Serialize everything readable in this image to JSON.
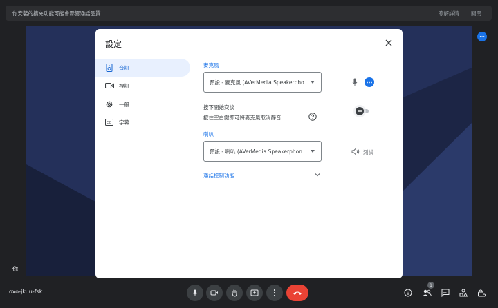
{
  "banner": {
    "message": "你安裝的擴充功能可能會影響通話品質",
    "learn_more": "瞭解詳情",
    "close": "關閉"
  },
  "participant": {
    "name": "你"
  },
  "meeting": {
    "code": "oxo-jkuu-fsk",
    "participants_count": "1"
  },
  "settings": {
    "title": "設定",
    "nav": [
      {
        "label": "音訊",
        "icon": "speaker-device-icon",
        "active": true
      },
      {
        "label": "視訊",
        "icon": "video-camera-icon",
        "active": false
      },
      {
        "label": "一般",
        "icon": "gear-icon",
        "active": false
      },
      {
        "label": "字幕",
        "icon": "closed-caption-icon",
        "active": false
      }
    ],
    "microphone": {
      "label": "麥克風",
      "selected": "預設 - 麥克風 (AVerMedia Speakerpho..."
    },
    "push_to_talk": {
      "title": "按下開始交談",
      "description": "按住空白鍵即可將麥克風取消靜音",
      "enabled": false
    },
    "speaker": {
      "label": "喇叭",
      "selected": "預設 - 喇叭 (AVerMedia Speakerphon...",
      "test_label": "測試"
    },
    "call_controls": {
      "label": "通話控制功能"
    }
  },
  "colors": {
    "accent": "#1a73e8",
    "end_call": "#ea4335",
    "active_nav_bg": "#e8f0fe"
  }
}
